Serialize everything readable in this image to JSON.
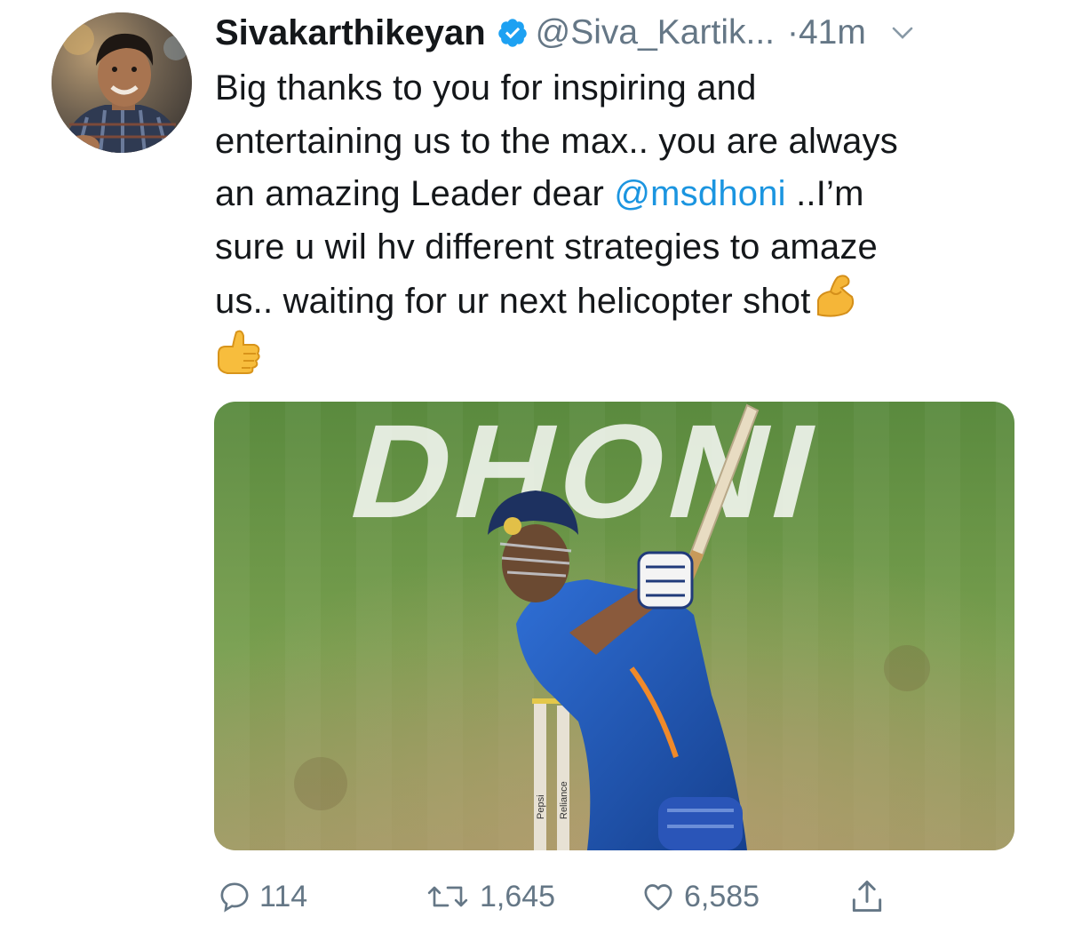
{
  "tweet": {
    "author_name": "Sivakarthikeyan",
    "handle": "@Siva_Kartik...",
    "separator": "·",
    "time": "41m",
    "text_lines": [
      "Big thanks to you for inspiring and",
      "entertaining us to the max.. you are always",
      "an amazing Leader dear ",
      "@msdhoni",
      " ..I’m",
      "sure u wil hv different strategies to amaze",
      "us.. waiting for ur next helicopter shot"
    ],
    "emojis": [
      "flexed-biceps-emoji",
      "thumbs-up-emoji"
    ],
    "media": {
      "ground_text": "DHONI",
      "stump_text_1": "Reliance",
      "stump_text_2": "Pepsi"
    }
  },
  "actions": {
    "replies": "114",
    "retweets": "1,645",
    "likes": "6,585"
  },
  "icons": {
    "verified": "verified-badge-icon",
    "chevron": "chevron-down-icon",
    "reply": "reply-icon",
    "retweet": "retweet-icon",
    "like": "heart-icon",
    "share": "share-icon"
  },
  "colors": {
    "text": "#14171a",
    "secondary": "#657786",
    "link": "#1b95e0",
    "verified": "#1da1f2"
  }
}
